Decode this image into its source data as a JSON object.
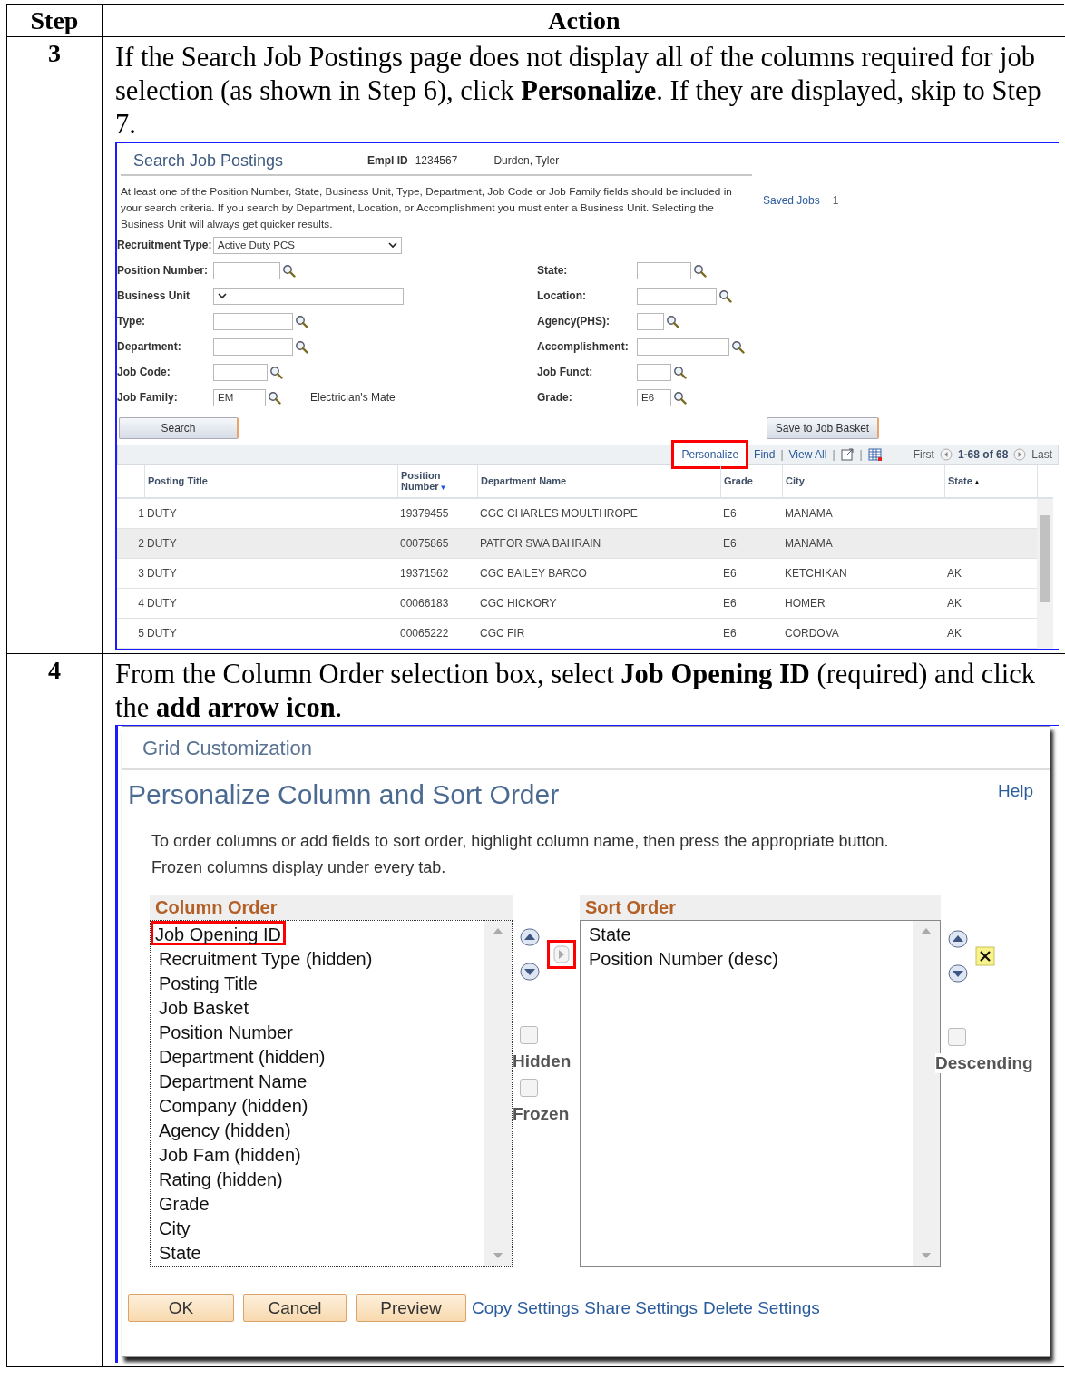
{
  "table": {
    "columns": [
      "Step",
      "Action"
    ]
  },
  "steps": [
    {
      "number": "3",
      "instruction": "If the Search Job Postings page does not display all of the columns required for job selection (as shown in Step 6), click **Personalize**. If they are displayed, skip to Step 7.",
      "screen": {
        "kind": "search_page",
        "title": "Search Job Postings",
        "empl_id_label": "Empl ID",
        "empl_id": "1234567",
        "employee_name": "Durden, Tyler",
        "notice": "At least one of the Position Number, State, Business Unit, Type, Department, Job Code or Job Family fields should be included in your search criteria. If you search by Department, Location, or Accomplishment you must enter a Business Unit. Selecting the Business Unit will always get quicker results.",
        "saved_jobs": {
          "label": "Saved Jobs",
          "count": "1"
        },
        "recruitment_type": {
          "label": "Recruitment Type:",
          "value": "Active Duty PCS"
        },
        "form_rows": [
          {
            "left": {
              "label": "Position Number:",
              "kind": "lookup"
            },
            "right": {
              "label": "State:",
              "kind": "lookup"
            }
          },
          {
            "left": {
              "label": "Business Unit",
              "kind": "dropdown"
            },
            "right": {
              "label": "Location:",
              "kind": "lookup"
            }
          },
          {
            "left": {
              "label": "Type:",
              "kind": "lookup"
            },
            "right": {
              "label": "Agency(PHS):",
              "kind": "lookup"
            }
          },
          {
            "left": {
              "label": "Department:",
              "kind": "lookup"
            },
            "right": {
              "label": "Accomplishment:",
              "kind": "lookup"
            }
          },
          {
            "left": {
              "label": "Job Code:",
              "kind": "lookup"
            },
            "right": {
              "label": "Job Funct:",
              "kind": "lookup"
            }
          },
          {
            "left": {
              "label": "Job Family:",
              "kind": "lookup",
              "value": "EM",
              "description": "Electrician's Mate"
            },
            "right": {
              "label": "Grade:",
              "kind": "lookup",
              "value": "E6"
            }
          }
        ],
        "search_button": "Search",
        "save_button": "Save to Job Basket",
        "toolbar": {
          "personalize": {
            "label": "Personalize",
            "highlighted": true
          },
          "find": "Find",
          "view_all": "View All",
          "separators": [
            "|",
            "|",
            "|"
          ],
          "first": "First",
          "range": "1-68 of 68",
          "last": "Last"
        },
        "columns": [
          {
            "label": "Posting Title"
          },
          {
            "label": "Position Number",
            "sort_marker": "▼"
          },
          {
            "label": "Department Name"
          },
          {
            "label": "Grade"
          },
          {
            "label": "City"
          },
          {
            "label": "State",
            "sort_marker": "▲"
          }
        ],
        "rows": [
          {
            "number": "1",
            "selected": false,
            "cells": [
              "DUTY",
              "19379455",
              "CGC CHARLES MOULTHROPE",
              "E6",
              "MANAMA",
              ""
            ]
          },
          {
            "number": "2",
            "selected": true,
            "cells": [
              "DUTY",
              "00075865",
              "PATFOR SWA BAHRAIN",
              "E6",
              "MANAMA",
              ""
            ]
          },
          {
            "number": "3",
            "selected": false,
            "cells": [
              "DUTY",
              "19371562",
              "CGC BAILEY BARCO",
              "E6",
              "KETCHIKAN",
              "AK"
            ]
          },
          {
            "number": "4",
            "selected": false,
            "cells": [
              "DUTY",
              "00066183",
              "CGC HICKORY",
              "E6",
              "HOMER",
              "AK"
            ]
          },
          {
            "number": "5",
            "selected": false,
            "cells": [
              "DUTY",
              "00065222",
              "CGC FIR",
              "E6",
              "CORDOVA",
              "AK"
            ]
          }
        ]
      }
    },
    {
      "number": "4",
      "instruction": "From the Column Order selection box, select **Job Opening ID** (required) and click the **add arrow icon**.",
      "screen": {
        "kind": "grid_customization",
        "title": "Grid Customization",
        "heading": "Personalize Column and Sort Order",
        "help": "Help",
        "instructions": "To order columns or add fields to sort order, highlight column name, then press the appropriate button. Frozen columns display under every tab.",
        "column_order": {
          "label": "Column Order",
          "items": [
            {
              "label": "Job Opening ID",
              "highlighted": true
            },
            {
              "label": "Recruitment Type (hidden)",
              "highlighted": false
            },
            {
              "label": "Posting Title",
              "highlighted": false
            },
            {
              "label": "Job Basket",
              "highlighted": false
            },
            {
              "label": "Position Number",
              "highlighted": false
            },
            {
              "label": "Department (hidden)",
              "highlighted": false
            },
            {
              "label": "Department Name",
              "highlighted": false
            },
            {
              "label": "Company (hidden)",
              "highlighted": false
            },
            {
              "label": "Agency (hidden)",
              "highlighted": false
            },
            {
              "label": "Job Fam (hidden)",
              "highlighted": false
            },
            {
              "label": "Rating (hidden)",
              "highlighted": false
            },
            {
              "label": "Grade",
              "highlighted": false
            },
            {
              "label": "City",
              "highlighted": false
            },
            {
              "label": "State",
              "highlighted": false
            }
          ]
        },
        "add_arrow": {
          "highlighted": true
        },
        "column_options": [
          {
            "label": "Hidden",
            "checked": false
          },
          {
            "label": "Frozen",
            "checked": false
          }
        ],
        "sort_order": {
          "label": "Sort Order",
          "items": [
            "State",
            "Position Number (desc)"
          ]
        },
        "sort_options": [
          {
            "label": "Descending",
            "checked": false
          }
        ],
        "buttons": [
          "OK",
          "Cancel",
          "Preview"
        ],
        "links": [
          "Copy Settings",
          "Share Settings",
          "Delete Settings"
        ]
      }
    }
  ]
}
